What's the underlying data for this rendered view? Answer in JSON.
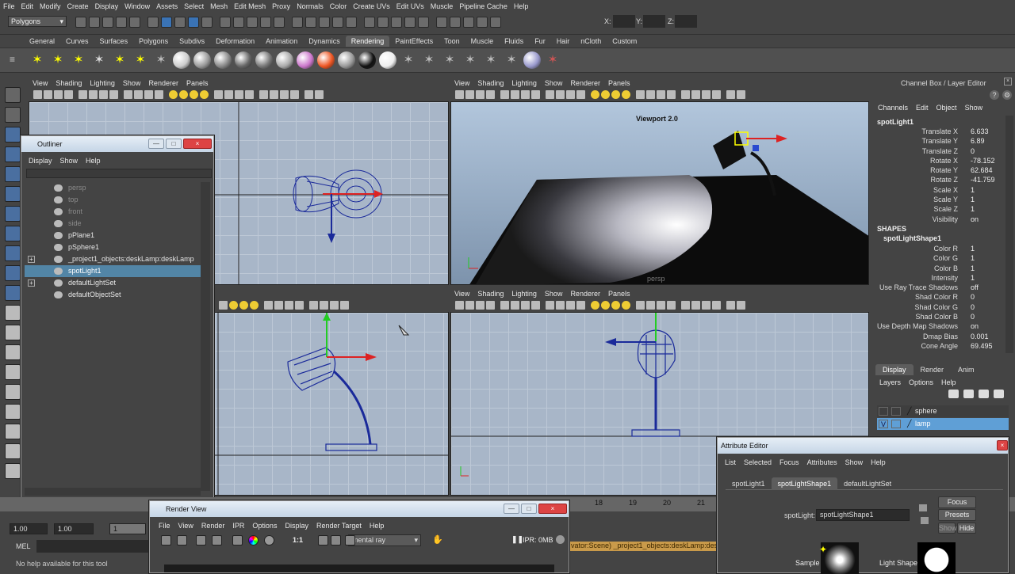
{
  "menubar": {
    "items": [
      "File",
      "Edit",
      "Modify",
      "Create",
      "Display",
      "Window",
      "Assets",
      "Select",
      "Mesh",
      "Edit Mesh",
      "Proxy",
      "Normals",
      "Color",
      "Create UVs",
      "Edit UVs",
      "Muscle",
      "Pipeline Cache",
      "Help"
    ]
  },
  "statusline": {
    "mode": "Polygons",
    "x_label": "X:",
    "y_label": "Y:",
    "z_label": "Z:"
  },
  "shelf": {
    "tabs": [
      "General",
      "Curves",
      "Surfaces",
      "Polygons",
      "Subdivs",
      "Deformation",
      "Animation",
      "Dynamics",
      "Rendering",
      "PaintEffects",
      "Toon",
      "Muscle",
      "Fluids",
      "Fur",
      "Hair",
      "nCloth",
      "Custom"
    ],
    "active": "Rendering"
  },
  "viewport_menu": [
    "View",
    "Shading",
    "Lighting",
    "Show",
    "Renderer",
    "Panels"
  ],
  "persp_viewport": {
    "label": "Viewport 2.0",
    "camera": "persp"
  },
  "outliner": {
    "title": "Outliner",
    "menu": [
      "Display",
      "Show",
      "Help"
    ],
    "items": [
      {
        "label": "persp",
        "state": "dim"
      },
      {
        "label": "top",
        "state": "dim"
      },
      {
        "label": "front",
        "state": "dim"
      },
      {
        "label": "side",
        "state": "dim"
      },
      {
        "label": "pPlane1",
        "state": "normal"
      },
      {
        "label": "pSphere1",
        "state": "normal"
      },
      {
        "label": "_project1_objects:deskLamp:deskLamp",
        "state": "normal"
      },
      {
        "label": "spotLight1",
        "state": "selected"
      },
      {
        "label": "defaultLightSet",
        "state": "normal"
      },
      {
        "label": "defaultObjectSet",
        "state": "normal"
      }
    ]
  },
  "channel_box": {
    "header": "Channel Box / Layer Editor",
    "menu": [
      "Channels",
      "Edit",
      "Object",
      "Show"
    ],
    "object": "spotLight1",
    "channels": [
      {
        "k": "Translate X",
        "v": "6.633"
      },
      {
        "k": "Translate Y",
        "v": "6.89"
      },
      {
        "k": "Translate Z",
        "v": "0"
      },
      {
        "k": "Rotate X",
        "v": "-78.152"
      },
      {
        "k": "Rotate Y",
        "v": "62.684"
      },
      {
        "k": "Rotate Z",
        "v": "-41.759"
      },
      {
        "k": "Scale X",
        "v": "1"
      },
      {
        "k": "Scale Y",
        "v": "1"
      },
      {
        "k": "Scale Z",
        "v": "1"
      },
      {
        "k": "Visibility",
        "v": "on"
      }
    ],
    "shapes_header": "SHAPES",
    "shape": "spotLightShape1",
    "shape_channels": [
      {
        "k": "Color R",
        "v": "1"
      },
      {
        "k": "Color G",
        "v": "1"
      },
      {
        "k": "Color B",
        "v": "1"
      },
      {
        "k": "Intensity",
        "v": "1"
      },
      {
        "k": "Use Ray Trace Shadows",
        "v": "off"
      },
      {
        "k": "Shad Color R",
        "v": "0"
      },
      {
        "k": "Shad Color G",
        "v": "0"
      },
      {
        "k": "Shad Color B",
        "v": "0"
      },
      {
        "k": "Use Depth Map Shadows",
        "v": "on"
      },
      {
        "k": "Dmap Bias",
        "v": "0.001"
      },
      {
        "k": "Cone Angle",
        "v": "69.495"
      }
    ]
  },
  "layer_editor": {
    "tabs": [
      "Display",
      "Render",
      "Anim"
    ],
    "menu": [
      "Layers",
      "Options",
      "Help"
    ],
    "layers": [
      {
        "name": "sphere",
        "selected": false
      },
      {
        "name": "lamp",
        "selected": true
      }
    ],
    "v_label": "V"
  },
  "timeline": {
    "ticks": [
      "18",
      "19",
      "20",
      "21"
    ]
  },
  "range": {
    "start": "1.00",
    "start2": "1.00",
    "cur": "1"
  },
  "command": {
    "lang": "MEL",
    "help": "No help available for this tool",
    "script_out": "vator:Scene)  _project1_objects:deskLamp:desk"
  },
  "render_view": {
    "title": "Render View",
    "menu": [
      "File",
      "View",
      "Render",
      "IPR",
      "Options",
      "Display",
      "Render Target",
      "Help"
    ],
    "renderer": "mental ray",
    "ipr": "IPR: 0MB",
    "ratio": "1:1"
  },
  "attribute_editor": {
    "title": "Attribute Editor",
    "menu": [
      "List",
      "Selected",
      "Focus",
      "Attributes",
      "Show",
      "Help"
    ],
    "tabs": [
      "spotLight1",
      "spotLightShape1",
      "defaultLightSet"
    ],
    "active_tab": "spotLightShape1",
    "field_label": "spotLight:",
    "field_value": "spotLightShape1",
    "focus_label": "Focus",
    "presets_label": "Presets",
    "show_label": "Show",
    "hide_label": "Hide",
    "sample_label": "Sample",
    "lightshape_label": "Light Shape"
  }
}
